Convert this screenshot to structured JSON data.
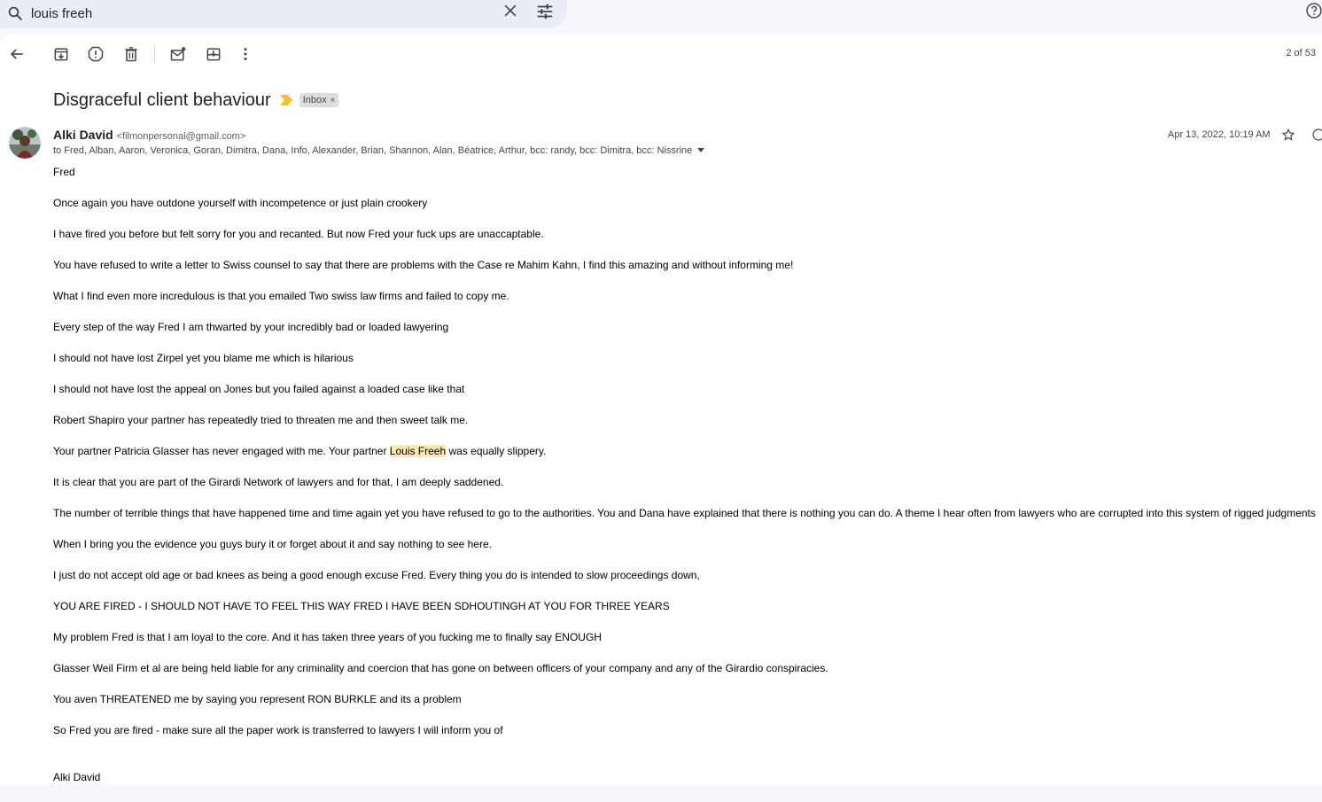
{
  "search": {
    "query": "louis freeh"
  },
  "counter": "2 of 53",
  "email": {
    "subject": "Disgraceful client behaviour",
    "label": "Inbox",
    "sender_name": "Alki David",
    "sender_email": "<filmonpersonal@gmail.com>",
    "recipients": "to Fred, Alban, Aaron, Veronica, Goran, Dimitra, Dana, Info, Alexander, Brian, Shannon, Alan, Béatrice, Arthur, bcc: randy, bcc: Dimitra, bcc: Nissrine",
    "date": "Apr 13, 2022, 10:19 AM",
    "body": {
      "greeting": "Fred",
      "p1": "Once again you have outdone yourself with incompetence or just plain crookery",
      "p2": "I have fired you before but felt sorry for you and recanted. But now Fred your fuck ups are unaccaptable.",
      "p3": "You have refused to write a letter to Swiss counsel to say that there are problems with the Case re Mahim Kahn, I find this amazing and without informing me!",
      "p4": "What I find even more incredulous is that you emailed Two swiss law firms and failed to copy me.",
      "p5": "Every step of the way Fred I am thwarted by your incredibly bad or loaded lawyering",
      "p6": "I should not have lost Zirpel yet you blame me which is hilarious",
      "p7": "I should not have lost the appeal on Jones but you failed against a loaded case like that",
      "p8": "Robert Shapiro your partner has repeatedly tried to threaten me and then sweet talk me.",
      "p9_before": "Your partner Patricia Glasser has never engaged with me. Your partner ",
      "p9_highlight": "Louis Freeh",
      "p9_after": " was equally slippery.",
      "p10": "It is clear that you are part of the Girardi Network of lawyers and for that, I am deeply saddened.",
      "p11": "The number of terrible things that have happened time and time again yet you have refused to go to the authorities. You and Dana have explained that there is nothing you can do. A theme I hear often from lawyers who are corrupted into this system of rigged judgments",
      "p12": "When I bring you the evidence you guys bury it or forget about it and say nothing to see here.",
      "p13": "I just do not accept old age or bad knees as being a good enough excuse Fred. Every thing you do is intended to slow proceedings down,",
      "p14": "YOU ARE FIRED - I SHOULD NOT HAVE TO FEEL THIS WAY FRED I HAVE BEEN SDHOUTINGH AT YOU FOR THREE YEARS",
      "p15": "My problem Fred is that I am loyal to the core. And it has taken three years of you fucking me to finally say ENOUGH",
      "p16": "Glasser Weil Firm et al are being held liable for any criminality and coercion that has gone on between officers of your company and any of the Girardio conspiracies.",
      "p17": "You aven THREATENED me by saying you represent RON BURKLE and its a problem",
      "p18": "So Fred you are fired - make sure all the paper work is transferred to lawyers I will inform you of",
      "signature": "Alki David"
    }
  },
  "colors": {
    "app_bg": "#f6f8fc",
    "search_bg": "#e9eef6",
    "highlight": "#fce8b2",
    "important_marker": "#f6bf26"
  },
  "icons": {
    "search": "search-icon",
    "clear": "close-icon",
    "tune": "tune-icon",
    "help": "help-icon",
    "back": "arrow-back-icon",
    "archive": "archive-icon",
    "spam": "report-spam-icon",
    "delete": "trash-icon",
    "unread": "mark-unread-icon",
    "move": "move-to-icon",
    "more": "more-vert-icon",
    "star": "star-icon",
    "emoji": "emoji-icon"
  }
}
